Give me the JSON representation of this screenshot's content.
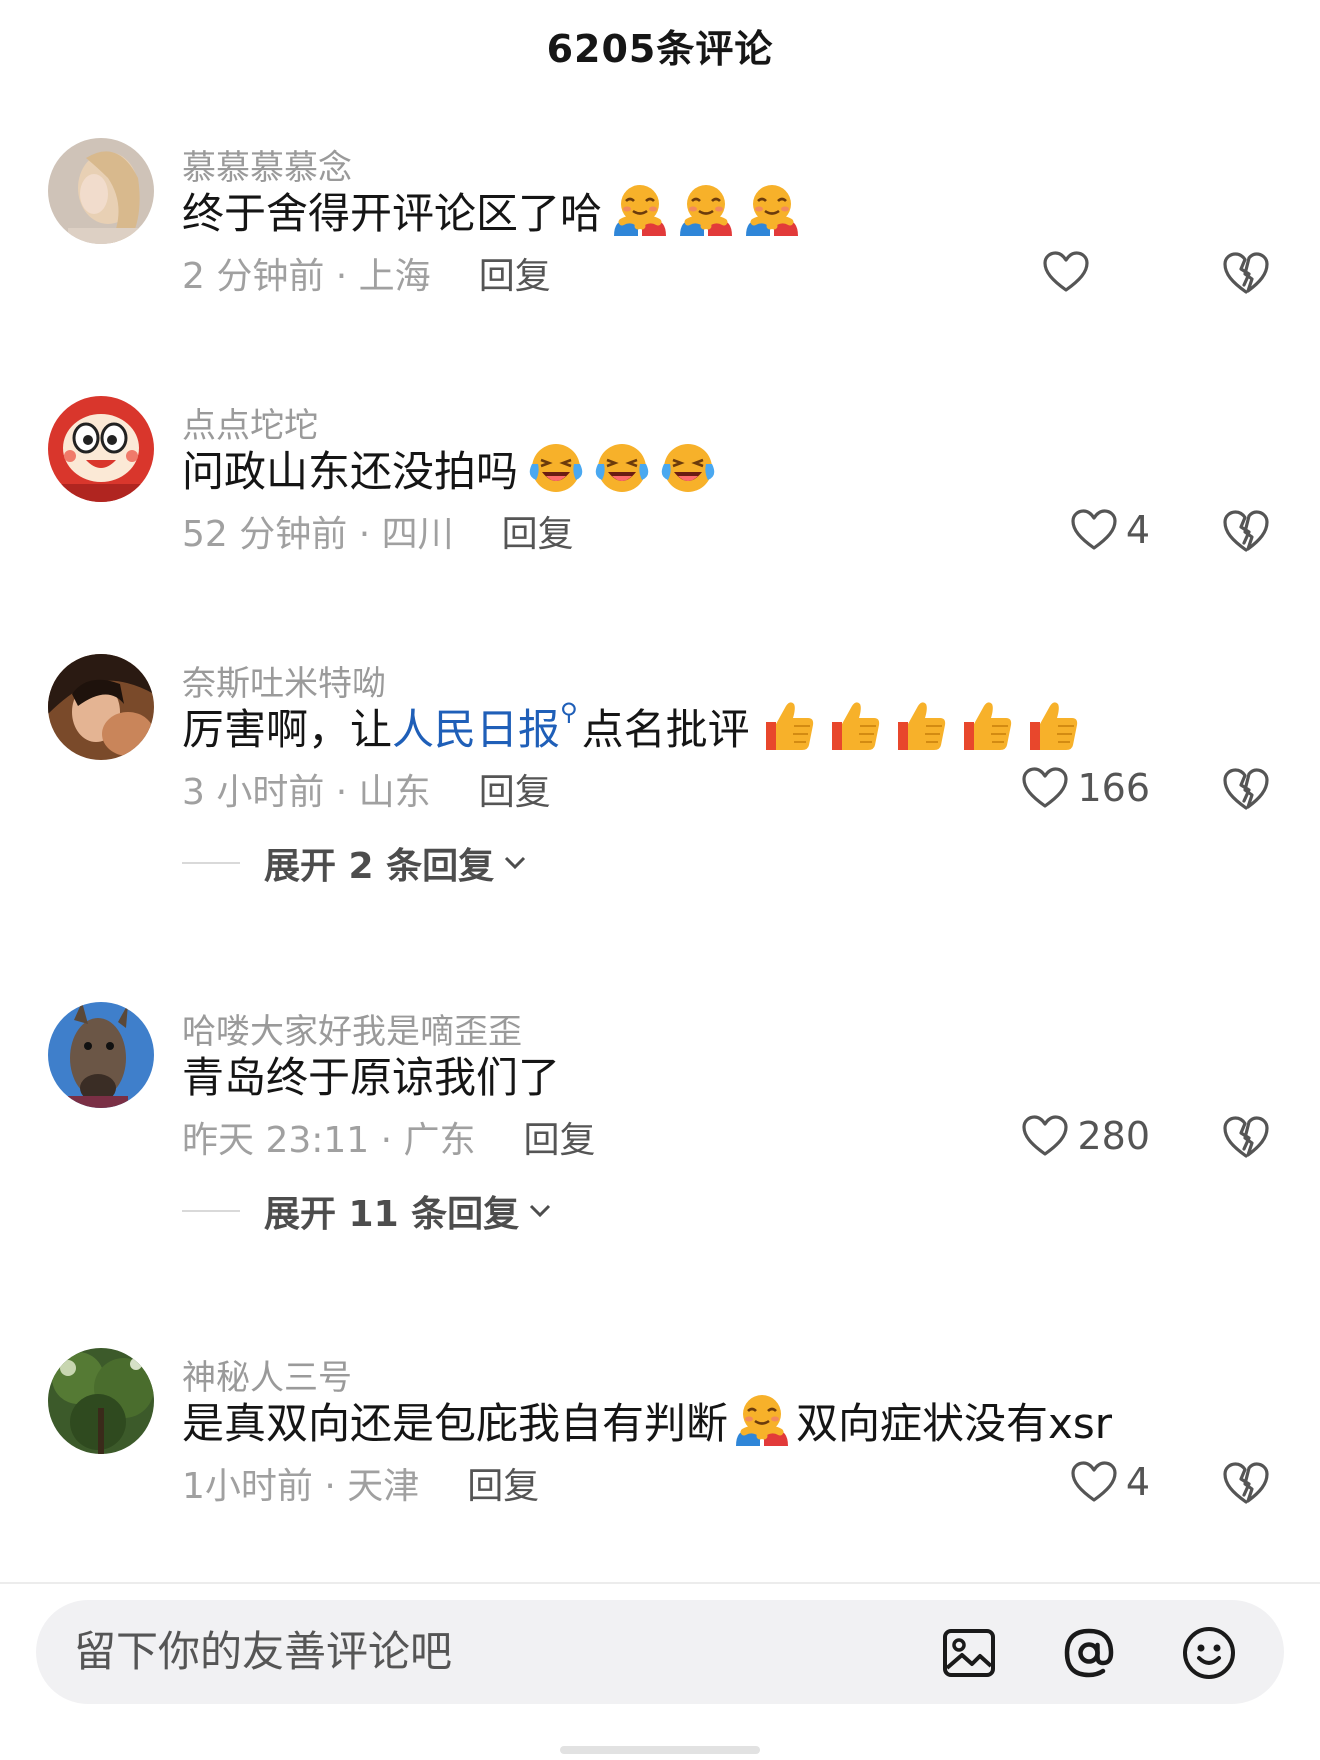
{
  "header": {
    "title": "6205条评论"
  },
  "comments": [
    {
      "username": "慕慕慕慕念",
      "text_parts": [
        "终于舍得开评论区了哈"
      ],
      "emojis": [
        "hug-emoji",
        "hug-emoji",
        "hug-emoji"
      ],
      "time_location": "2 分钟前 · 上海",
      "reply_label": "回复",
      "like_count": ""
    },
    {
      "username": "点点坨坨",
      "text_parts": [
        "问政山东还没拍吗"
      ],
      "emojis": [
        "laugh-cry-emoji",
        "laugh-cry-emoji",
        "laugh-cry-emoji"
      ],
      "time_location": "52 分钟前 · 四川",
      "reply_label": "回复",
      "like_count": "4"
    },
    {
      "username": "奈斯吐米特呦",
      "text_before": "厉害啊，让",
      "link_text": "人民日报",
      "text_after": "点名批评",
      "emojis": [
        "thumbs-up-emoji",
        "thumbs-up-emoji",
        "thumbs-up-emoji",
        "thumbs-up-emoji",
        "thumbs-up-emoji"
      ],
      "time_location": "3 小时前 · 山东",
      "reply_label": "回复",
      "like_count": "166",
      "expand_label": "展开 2 条回复"
    },
    {
      "username": "哈喽大家好我是嘀歪歪",
      "text_parts": [
        "青岛终于原谅我们了"
      ],
      "emojis": [],
      "time_location": "昨天 23:11 · 广东",
      "reply_label": "回复",
      "like_count": "280",
      "expand_label": "展开 11 条回复"
    },
    {
      "username": "神秘人三号",
      "text_before": "是真双向还是包庇我自有判断",
      "text_after": "双向症状没有xsr",
      "emojis": [
        "hug-emoji"
      ],
      "time_location": "1小时前 · 天津",
      "reply_label": "回复",
      "like_count": "4"
    }
  ],
  "input_bar": {
    "placeholder": "留下你的友善评论吧",
    "icons": [
      "image-icon",
      "at-icon",
      "emoji-icon"
    ]
  },
  "colors": {
    "link": "#1f5fb8",
    "username": "#9a9a9a",
    "meta": "#a0a0a0",
    "input_bg": "#f1f1f3"
  }
}
